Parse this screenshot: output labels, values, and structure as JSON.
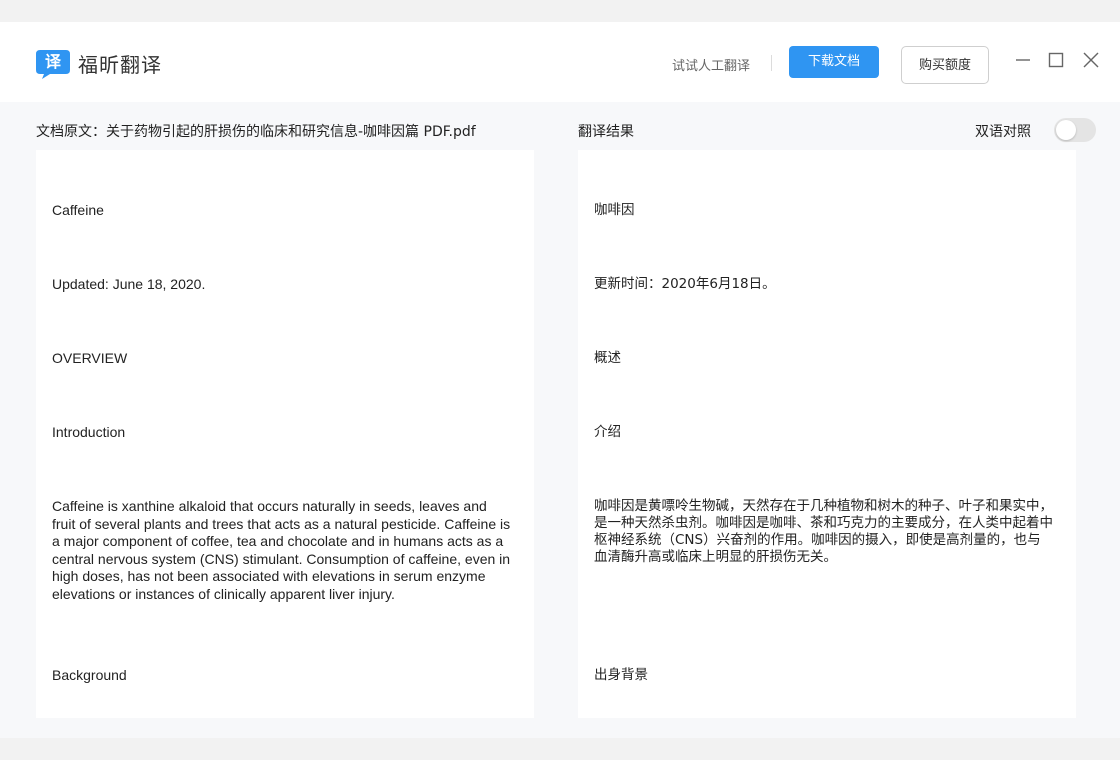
{
  "app": {
    "name": "福昕翻译",
    "logo_glyph": "译",
    "brand_color": "#2f95f2"
  },
  "header": {
    "human_translation": "试试人工翻译",
    "download": "下载文档",
    "buy_quota": "购买额度"
  },
  "source": {
    "title": "文档原文：关于药物引起的肝损伤的临床和研究信息-咖啡因篇 PDF.pdf",
    "paragraphs": [
      "Caffeine",
      "Updated: June 18, 2020.",
      "OVERVIEW",
      "Introduction",
      "Caffeine is xanthine alkaloid that occurs naturally in seeds, leaves and fruit of several plants and trees that acts as a natural pesticide. Caffeine is a major component of coffee, tea and chocolate and in humans acts as a central nervous system (CNS) stimulant. Consumption of caffeine, even in high doses, has not been associated with elevations in serum enzyme elevations or instances of clinically apparent liver injury.",
      "Background"
    ]
  },
  "translation": {
    "title": "翻译结果",
    "bilingual_label": "双语对照",
    "bilingual_on": false,
    "paragraphs": [
      "咖啡因",
      "更新时间：2020年6月18日。",
      "概述",
      "介绍",
      "咖啡因是黄嘌呤生物碱，天然存在于几种植物和树木的种子、叶子和果实中，是一种天然杀虫剂。咖啡因是咖啡、茶和巧克力的主要成分，在人类中起着中枢神经系统（CNS）兴奋剂的作用。咖啡因的摄入，即使是高剂量的，也与血清酶升高或临床上明显的肝损伤无关。",
      "出身背景"
    ]
  }
}
